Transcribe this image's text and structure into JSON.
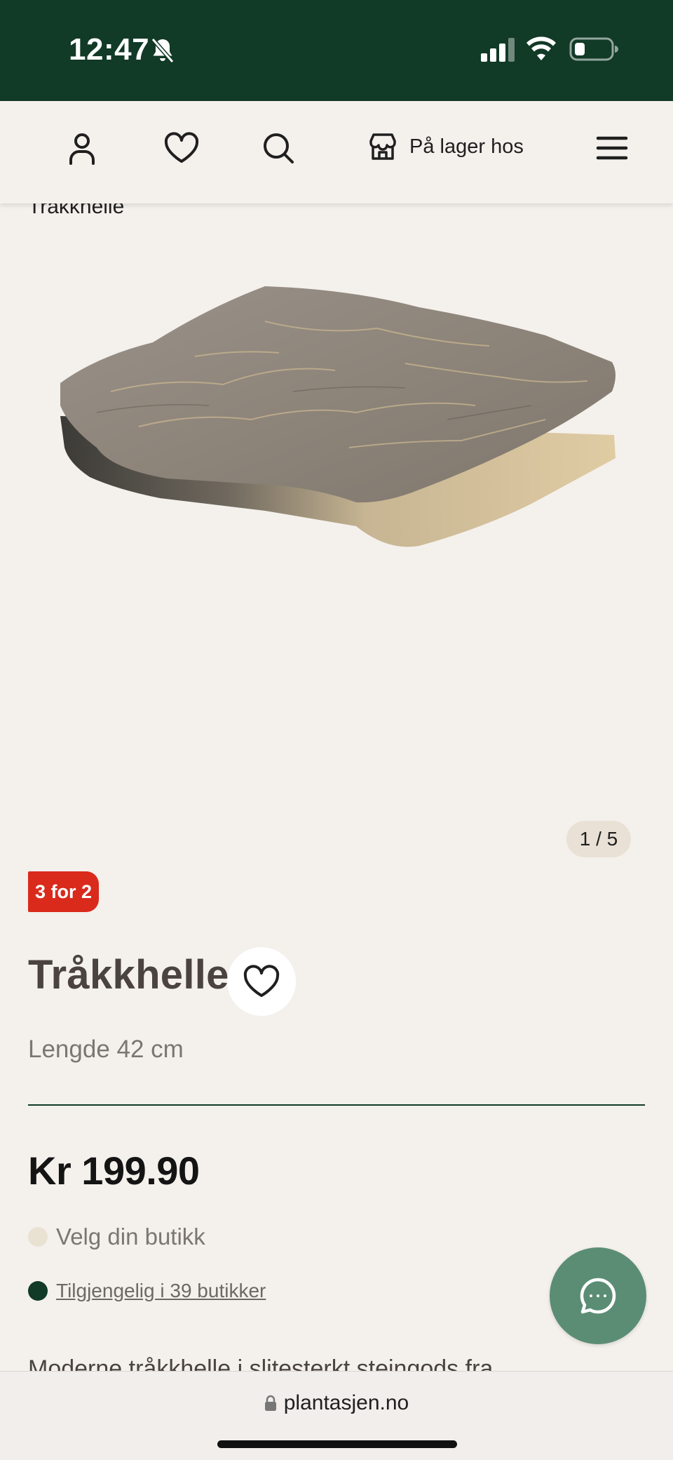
{
  "status_bar": {
    "time": "12:47",
    "icons": [
      "bell-slash-icon",
      "signal-icon",
      "wifi-icon",
      "battery-icon"
    ],
    "background": "#113a27"
  },
  "nav": {
    "icons": [
      "user-icon",
      "heart-icon",
      "search-icon",
      "store-icon",
      "menu-icon"
    ],
    "store_label": "På lager hos"
  },
  "breadcrumb": "Tråkkhelle",
  "gallery": {
    "counter": "1 / 5",
    "image_alt": "stepping-stone"
  },
  "product": {
    "badge": "3 for 2",
    "title": "Tråkkhelle",
    "subtitle": "Lengde 42 cm",
    "price": "Kr 199.90",
    "store_select": "Velg din butikk",
    "availability": "Tilgjengelig i 39 butikker",
    "description": "Moderne tråkkhelle i slitesterkt steingods fra"
  },
  "browser": {
    "url": "plantasjen.no"
  },
  "colors": {
    "brand_green": "#113a27",
    "badge_red": "#d92a1c",
    "chat_green": "#5b8d75",
    "background": "#f4f0ec"
  }
}
